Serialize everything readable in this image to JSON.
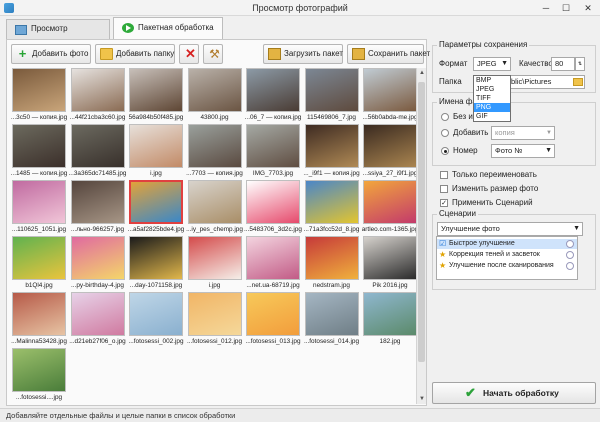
{
  "window": {
    "title": "Просмотр фотографий"
  },
  "tabs": [
    {
      "label": "Просмотр"
    },
    {
      "label": "Пакетная обработка"
    }
  ],
  "toolbar": {
    "add_photo": "Добавить фото",
    "add_folder": "Добавить папку",
    "load_batch": "Загрузить пакет",
    "save_batch": "Сохранить пакет"
  },
  "photos": [
    {
      "caption": "...3c50 — копия.jpg",
      "colors": [
        "#7a5a3c",
        "#c9a57a"
      ]
    },
    {
      "caption": "...44f21cba3c60.jpg",
      "colors": [
        "#e6e2df",
        "#8a6b53"
      ]
    },
    {
      "caption": "56a984b50f485.jpg",
      "colors": [
        "#c7bfb9",
        "#5e4634"
      ]
    },
    {
      "caption": "43800.jpg",
      "colors": [
        "#b9b1a9",
        "#6b5543"
      ]
    },
    {
      "caption": "...06_7 — копия.jpg",
      "colors": [
        "#8c9aa6",
        "#4a3c34"
      ]
    },
    {
      "caption": "115469806_7.jpg",
      "colors": [
        "#7c8794",
        "#5e4a3d"
      ]
    },
    {
      "caption": "...56b0abda-me.jpg",
      "colors": [
        "#c0cbd3",
        "#7b5a3f"
      ]
    },
    {
      "caption": "...1485 — копия.jpg",
      "colors": [
        "#6c6a5e",
        "#3b2f2a"
      ]
    },
    {
      "caption": "...3a365dc71485.jpg",
      "colors": [
        "#6c6a60",
        "#38302b"
      ]
    },
    {
      "caption": "i.jpg",
      "colors": [
        "#e7e0da",
        "#c28a66"
      ]
    },
    {
      "caption": "...7703 — копия.jpg",
      "colors": [
        "#9aa09c",
        "#5a4a40"
      ]
    },
    {
      "caption": "IMG_7703.jpg",
      "colors": [
        "#a5a9a4",
        "#5f4d41"
      ]
    },
    {
      "caption": "..._i9f1 — копия.jpg",
      "colors": [
        "#3e2b22",
        "#b08a55"
      ]
    },
    {
      "caption": "...ssiya_27_i9f1.jpg",
      "colors": [
        "#3a2a20",
        "#aa8550"
      ]
    },
    {
      "caption": "...110625_1051.jpg",
      "colors": [
        "#c06aa0",
        "#f1c6d8"
      ]
    },
    {
      "caption": "...льно-966257.jpg",
      "colors": [
        "#55453d",
        "#a79686"
      ]
    },
    {
      "caption": "...a5af2825bde4.jpg",
      "colors": [
        "#e2a23a",
        "#3b88c8"
      ]
    },
    {
      "caption": "...iy_pes_chemp.jpg",
      "colors": [
        "#d8d3cc",
        "#a98e67"
      ]
    },
    {
      "caption": "...5483706_3d2c.jpg",
      "colors": [
        "#ffffff",
        "#e64a6c"
      ]
    },
    {
      "caption": "...71a3fcc52d_8.jpg",
      "colors": [
        "#4b86c8",
        "#e3c52f"
      ]
    },
    {
      "caption": "artleo.com-1365.jpg",
      "colors": [
        "#f2a63c",
        "#c33a6b"
      ]
    },
    {
      "caption": "b1Ql4.jpg",
      "colors": [
        "#60b24f",
        "#eac43d"
      ]
    },
    {
      "caption": "...py-birthday-4.jpg",
      "colors": [
        "#e06aa0",
        "#f4d66a"
      ]
    },
    {
      "caption": "...day-1071158.jpg",
      "colors": [
        "#1b1b1b",
        "#e1b74b"
      ]
    },
    {
      "caption": "i.jpg",
      "colors": [
        "#d44b4b",
        "#f5efe9"
      ]
    },
    {
      "caption": "...net.ua-68719.jpg",
      "colors": [
        "#f3d4df",
        "#c25b86"
      ]
    },
    {
      "caption": "nedstram.jpg",
      "colors": [
        "#c63a3a",
        "#f0b13c"
      ]
    },
    {
      "caption": "Pik 2016.jpg",
      "colors": [
        "#d5d1cc",
        "#2b2b2b"
      ]
    },
    {
      "caption": "...Malinna53428.jpg",
      "colors": [
        "#b65a48",
        "#e7c4a4"
      ]
    },
    {
      "caption": "...d21eb27f06_o.jpg",
      "colors": [
        "#e7d2e8",
        "#d07aa0"
      ]
    },
    {
      "caption": "...fotosessi_002.jpg",
      "colors": [
        "#bfd6e7",
        "#8ab0cf"
      ]
    },
    {
      "caption": "...fotosessi_012.jpg",
      "colors": [
        "#f1b566",
        "#f5d89a"
      ]
    },
    {
      "caption": "...fotosessi_013.jpg",
      "colors": [
        "#f7c95a",
        "#f29d3c"
      ]
    },
    {
      "caption": "...fotosessi_014.jpg",
      "colors": [
        "#a5b6c3",
        "#6f7e86"
      ]
    },
    {
      "caption": "182.jpg",
      "colors": [
        "#8fb7cf",
        "#5b8a6a"
      ]
    },
    {
      "caption": "...fotosessi....jpg",
      "colors": [
        "#9bbf6b",
        "#4a7d3a"
      ]
    }
  ],
  "save_params": {
    "legend": "Параметры сохранения",
    "format_label": "Формат",
    "format_value": "JPEG",
    "format_options": [
      "BMP",
      "JPEG",
      "TIFF",
      "PNG",
      "GIF"
    ],
    "quality_label": "Качество",
    "quality_value": "80",
    "folder_label": "Папка",
    "folder_value": "blic\\Pictures"
  },
  "file_names": {
    "legend": "Имена фай",
    "opt_none": "Без изменения",
    "opt_add": "Добавить",
    "add_placeholder": "копия",
    "opt_number": "Номер",
    "number_pattern": "Фото №"
  },
  "checkboxes": {
    "rename_only": "Только переименовать",
    "resize": "Изменить размер фото",
    "apply_scenario": "Применить Сценарий"
  },
  "scenarios": {
    "legend": "Сценарии",
    "selected": "Улучшение фото",
    "items": [
      "Быстрое улучшение",
      "Коррекция теней и засветок",
      "Улучшение после сканирования"
    ]
  },
  "process_button": "Начать обработку",
  "status_bar": "Добавляйте отдельные файлы и целые папки в список обработки"
}
